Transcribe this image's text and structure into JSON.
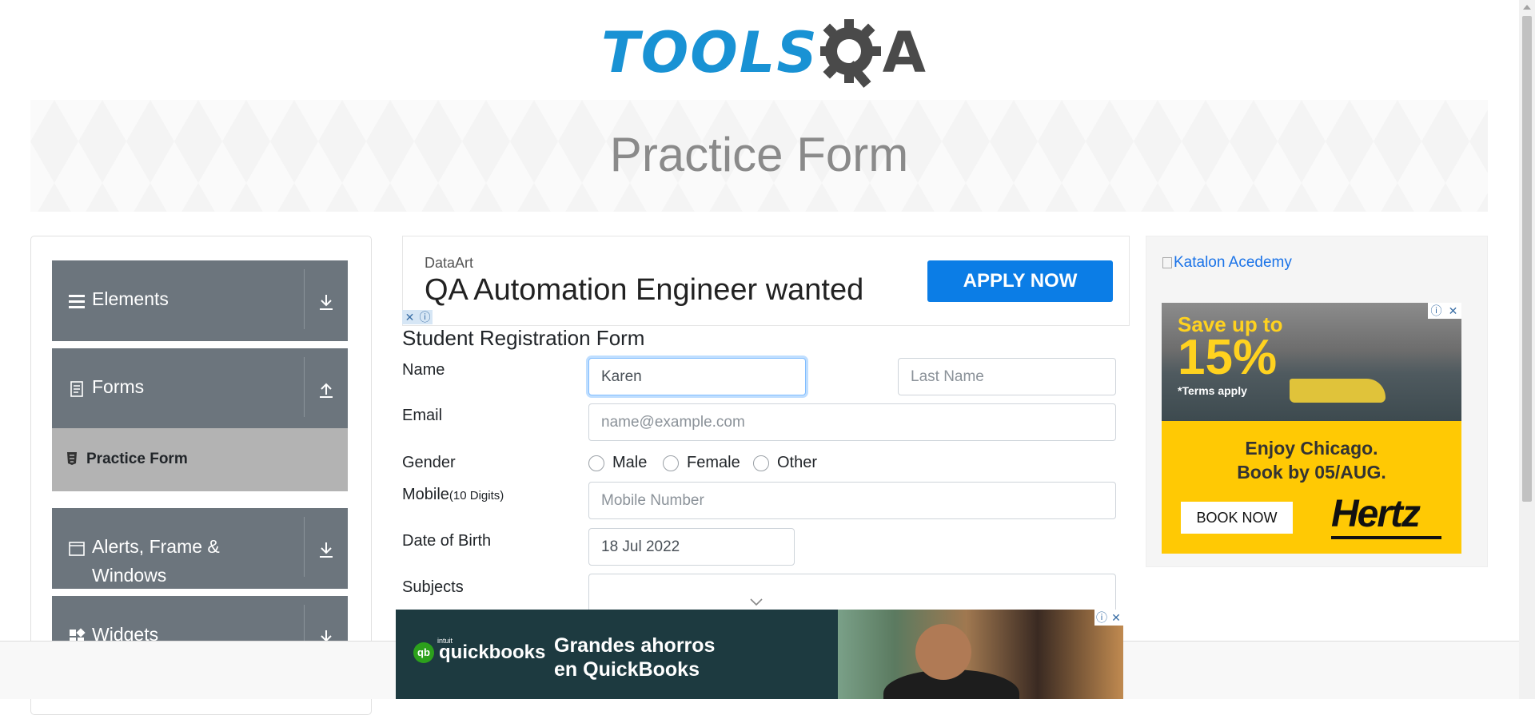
{
  "logo": {
    "text_left": "TOOLS",
    "text_right": "A"
  },
  "banner": {
    "title": "Practice Form"
  },
  "sidebar": {
    "groups": [
      {
        "label": "Elements",
        "icon": "hamburger-icon",
        "arrow": "download-arrow-icon"
      },
      {
        "label": "Forms",
        "icon": "document-icon",
        "arrow": "upload-arrow-icon"
      },
      {
        "label": "Alerts, Frame & Windows",
        "icon": "window-icon",
        "arrow": "download-arrow-icon"
      },
      {
        "label": "Widgets",
        "icon": "widgets-icon",
        "arrow": "download-arrow-icon"
      }
    ],
    "active_item": {
      "label": "Practice Form",
      "icon": "html5-icon"
    }
  },
  "ad_top": {
    "brand": "DataArt",
    "headline": "QA Automation Engineer wanted",
    "cta": "APPLY NOW",
    "close": "✕",
    "info": "ⓘ"
  },
  "form": {
    "title": "Student Registration Form",
    "name_label": "Name",
    "first_name_value": "Karen",
    "first_name_placeholder": "First Name",
    "last_name_placeholder": "Last Name",
    "email_label": "Email",
    "email_placeholder": "name@example.com",
    "gender_label": "Gender",
    "gender_options": [
      "Male",
      "Female",
      "Other"
    ],
    "mobile_label": "Mobile",
    "mobile_hint": "(10 Digits)",
    "mobile_placeholder": "Mobile Number",
    "dob_label": "Date of Birth",
    "dob_value": "18 Jul 2022",
    "subjects_label": "Subjects"
  },
  "right_ad": {
    "link_text": "Katalon Acedemy",
    "save_text": "Save up to",
    "percent": "15%",
    "terms": "*Terms apply",
    "enjoy_line1": "Enjoy Chicago.",
    "enjoy_line2": "Book by 05/AUG.",
    "cta": "BOOK NOW",
    "brand": "Hertz"
  },
  "bottom_ad": {
    "intuit": "intuit",
    "brand": "quickbooks",
    "line1": "Grandes ahorros",
    "line2": "en QuickBooks"
  },
  "colors": {
    "logo_blue": "#1992d4",
    "sidebar_bg": "#6c757d",
    "apply_blue": "#0b7de6",
    "hertz_yellow": "#ffc904"
  }
}
